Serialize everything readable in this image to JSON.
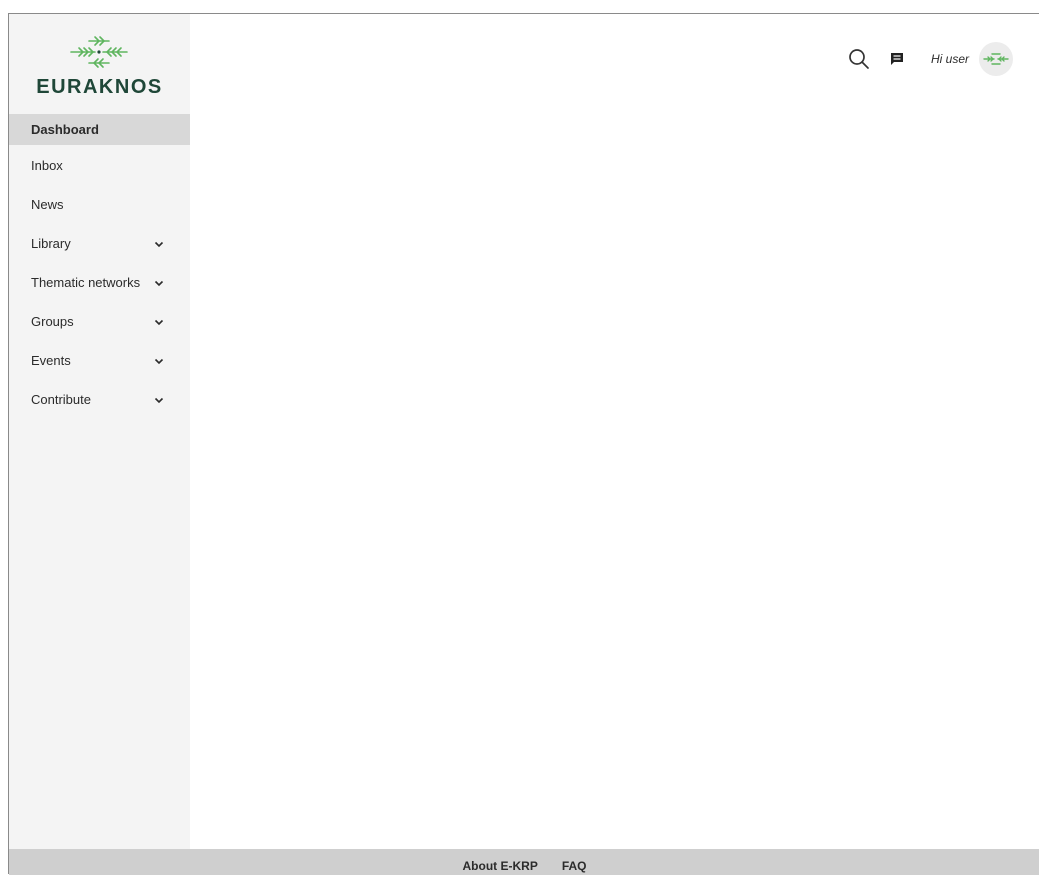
{
  "brand": {
    "name": "EURAKNOS",
    "color": "#1f4738",
    "accent": "#5fb55f"
  },
  "sidebar": {
    "items": [
      {
        "label": "Dashboard",
        "active": true,
        "has_children": false
      },
      {
        "label": "Inbox",
        "active": false,
        "has_children": false
      },
      {
        "label": "News",
        "active": false,
        "has_children": false
      },
      {
        "label": "Library",
        "active": false,
        "has_children": true
      },
      {
        "label": "Thematic networks",
        "active": false,
        "has_children": true
      },
      {
        "label": "Groups",
        "active": false,
        "has_children": true
      },
      {
        "label": "Events",
        "active": false,
        "has_children": true
      },
      {
        "label": "Contribute",
        "active": false,
        "has_children": true
      }
    ]
  },
  "header": {
    "icons": [
      "search-icon",
      "message-icon"
    ],
    "greeting": "Hi user"
  },
  "footer": {
    "links": [
      "About E-KRP",
      "FAQ"
    ]
  }
}
